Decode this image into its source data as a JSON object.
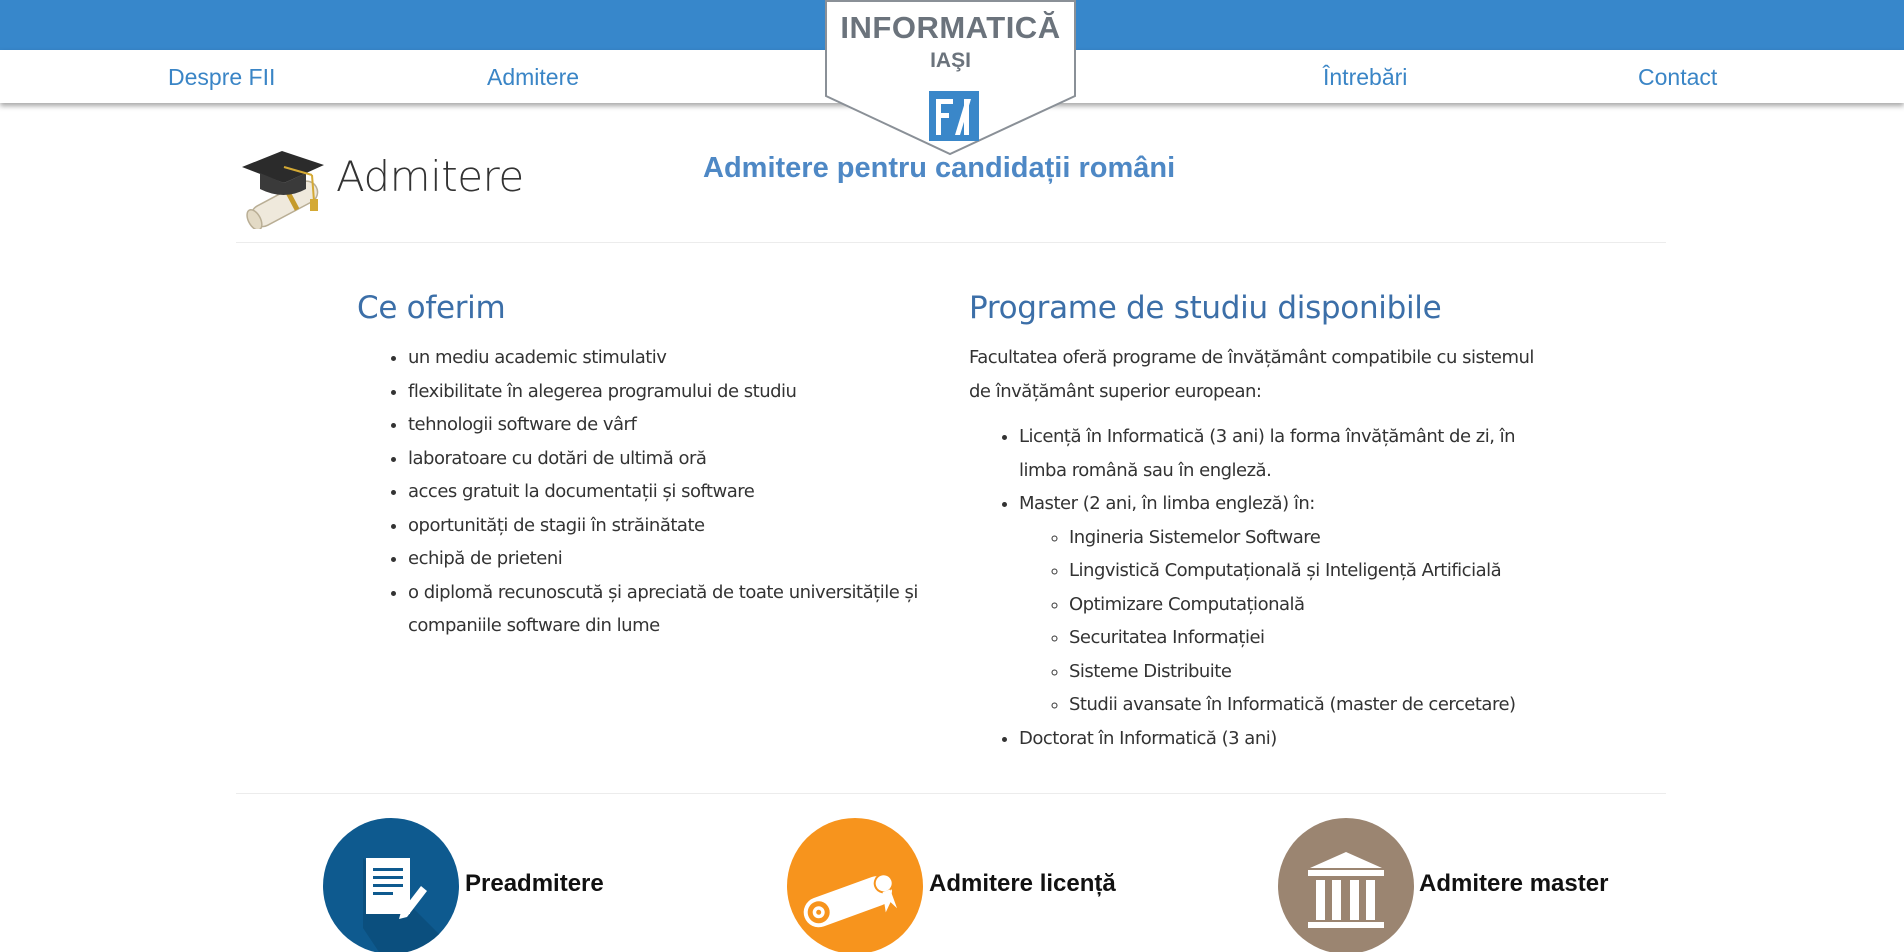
{
  "nav": {
    "items": [
      {
        "label": "Despre FII"
      },
      {
        "label": "Admitere"
      },
      {
        "label": "Întrebări"
      },
      {
        "label": "Contact"
      }
    ]
  },
  "logo": {
    "line1": "INFORMATICĂ",
    "line2": "IAŞI",
    "mark": "FI"
  },
  "header": {
    "title": "Admitere",
    "subtitle": "Admitere pentru candidații români",
    "icon": "graduation-cap-icon"
  },
  "offer": {
    "title": "Ce oferim",
    "items": [
      "un mediu academic stimulativ",
      "flexibilitate în alegerea programului de studiu",
      "tehnologii software de vârf",
      "laboratoare cu dotări de ultimă oră",
      "acces gratuit la documentații și software",
      "oportunități de stagii în străinătate",
      "echipă de prieteni",
      "o diplomă recunoscută și apreciată de toate universitățile și",
      "companiile software din lume"
    ]
  },
  "programs": {
    "title": "Programe de studiu disponibile",
    "intro_line1": "Facultatea oferă programe de învățământ compatibile cu sistemul",
    "intro_line2": "de învățământ superior european:",
    "licenta_line1": "Licență în Informatică (3 ani) la forma învățământ de zi, în",
    "licenta_line2": "limba română sau în engleză.",
    "master": "Master (2 ani, în limba engleză) în:",
    "master_items": [
      "Ingineria Sistemelor Software",
      "Lingvistică Computațională și Inteligență Artificială",
      "Optimizare Computațională",
      "Securitatea Informației",
      "Sisteme Distribuite",
      "Studii avansate în Informatică (master de cercetare)"
    ],
    "doctorat": "Doctorat în Informatică (3 ani)"
  },
  "cards": [
    {
      "label": "Preadmitere",
      "icon": "document-edit-icon",
      "color": "#0e5a8f"
    },
    {
      "label": "Admitere licență",
      "icon": "diploma-scroll-icon",
      "color": "#f7941d"
    },
    {
      "label": "Admitere master",
      "icon": "institution-building-icon",
      "color": "#9b8571"
    }
  ],
  "colors": {
    "topbar": "#3787cb",
    "nav_link": "#3a85c6",
    "section_title": "#3c6fa8",
    "subtitle": "#4e88c5"
  }
}
